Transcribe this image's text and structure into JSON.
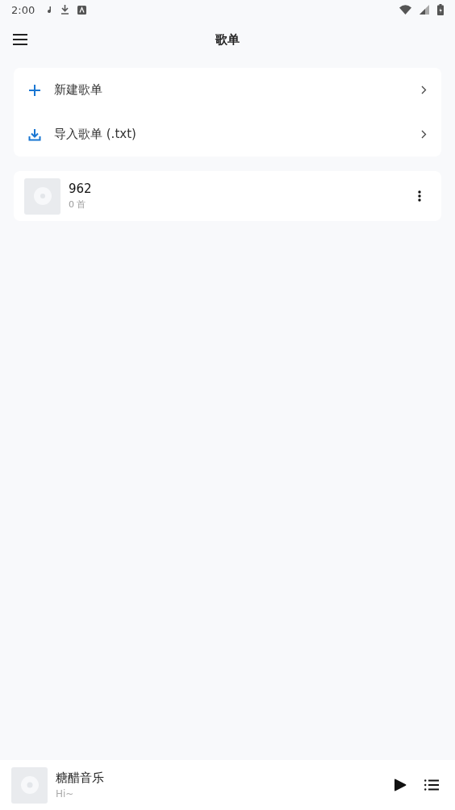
{
  "status_bar": {
    "time": "2:00"
  },
  "app_bar": {
    "title": "歌单"
  },
  "actions": [
    {
      "kind": "add",
      "label": "新建歌单"
    },
    {
      "kind": "import",
      "label": "导入歌单 (.txt)"
    }
  ],
  "playlists": [
    {
      "name": "962",
      "count": "0 首"
    }
  ],
  "player": {
    "title": "糖醋音乐",
    "subtitle": "Hi~"
  }
}
